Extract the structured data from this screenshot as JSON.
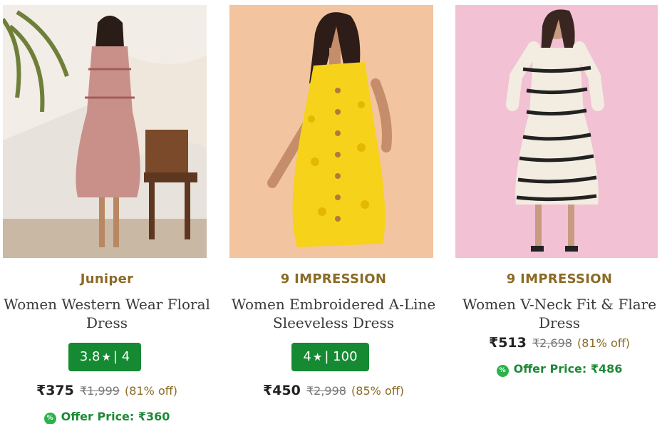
{
  "products": [
    {
      "brand": "Juniper",
      "title_line1": "Women Western Wear Floral",
      "title_line2": "Dress",
      "rating": "3.8",
      "rating_count": "4",
      "price": "₹375",
      "mrp": "₹1,999",
      "discount": "(81% off)",
      "offer_text": "Offer Price: ₹360",
      "photo_bg": "#e8e2dc",
      "dress_color": "#c9908a"
    },
    {
      "brand": "9 IMPRESSION",
      "title_line1": "Women Embroidered A-Line",
      "title_line2": "Sleeveless Dress",
      "rating": "4",
      "rating_count": "100",
      "price": "₹450",
      "mrp": "₹2,998",
      "discount": "(85% off)",
      "photo_bg": "#f2c4a0",
      "dress_color": "#f6d21a"
    },
    {
      "brand": "9 IMPRESSION",
      "title_line1": "Women V-Neck Fit & Flare",
      "title_line2": "Dress",
      "price": "₹513",
      "mrp": "₹2,698",
      "discount": "(81% off)",
      "offer_text": "Offer Price: ₹486",
      "photo_bg": "#f0bdd0",
      "dress_color": "#f3ece0"
    }
  ],
  "icons": {
    "star": "star-icon",
    "offer": "percent-badge-icon"
  },
  "colors": {
    "brand_text": "#8a6a25",
    "rating_badge": "#158a32",
    "offer_text": "#1d8a36"
  }
}
